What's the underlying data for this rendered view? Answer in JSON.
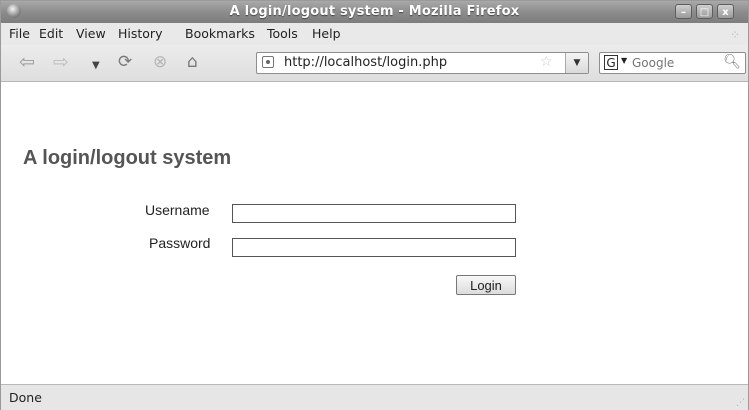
{
  "window": {
    "title": "A login/logout system - Mozilla Firefox",
    "controls": {
      "minimize": "–",
      "maximize": "□",
      "close": "x"
    }
  },
  "menubar": {
    "items": [
      "File",
      "Edit",
      "View",
      "History",
      "Bookmarks",
      "Tools",
      "Help"
    ]
  },
  "toolbar": {
    "icons": [
      "back-arrow-icon",
      "forward-arrow-icon",
      "history-dropdown-icon",
      "reload-icon",
      "stop-icon",
      "home-icon"
    ],
    "url": "http://localhost/login.php",
    "search_engine": "G",
    "search_placeholder": "Google"
  },
  "page": {
    "heading": "A login/logout system",
    "username_label": "Username",
    "password_label": "Password",
    "username_value": "",
    "password_value": "",
    "login_button": "Login"
  },
  "statusbar": {
    "text": "Done"
  },
  "colors": {
    "heading": "#555555",
    "titlebar": "#8c8c8c",
    "chrome": "#e6e6e6"
  }
}
